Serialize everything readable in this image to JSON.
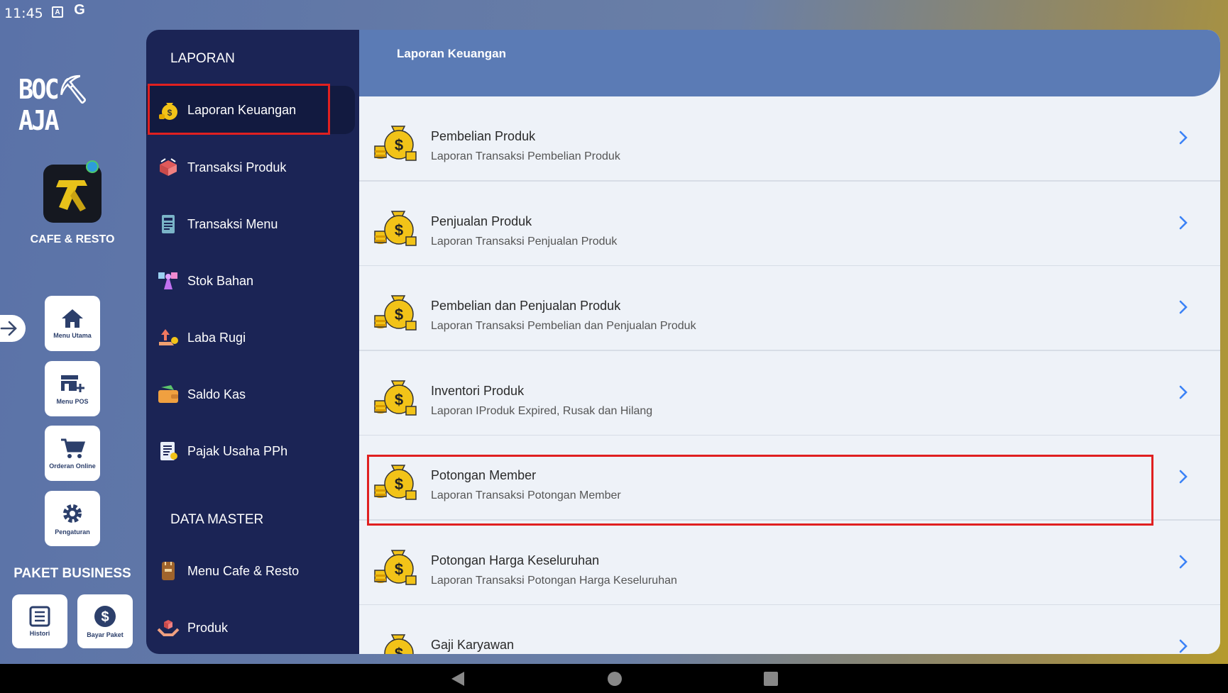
{
  "status_bar": {
    "time": "11:45",
    "icons": [
      "a-badge-icon",
      "google-icon"
    ]
  },
  "left_rail": {
    "logo_text": "BOC⛏AJA",
    "app_label": "CAFE & RESTO",
    "tiles": [
      {
        "label": "Menu Utama",
        "icon": "home-icon"
      },
      {
        "label": "Menu POS",
        "icon": "store-add-icon"
      },
      {
        "label": "Orderan Online",
        "icon": "cart-icon"
      },
      {
        "label": "Pengaturan",
        "icon": "gear-icon"
      }
    ],
    "paket_label": "PAKET BUSINESS",
    "paket_tiles": [
      {
        "label": "Histori",
        "icon": "list-icon"
      },
      {
        "label": "Bayar Paket",
        "icon": "dollar-icon"
      }
    ]
  },
  "menu": {
    "section_laporan": "LAPORAN",
    "laporan_items": [
      {
        "label": "Laporan Keuangan",
        "active": true
      },
      {
        "label": "Transaksi Produk"
      },
      {
        "label": "Transaksi Menu"
      },
      {
        "label": "Stok Bahan"
      },
      {
        "label": "Laba Rugi"
      },
      {
        "label": "Saldo Kas"
      },
      {
        "label": "Pajak Usaha PPh"
      }
    ],
    "section_master": "DATA MASTER",
    "master_items": [
      {
        "label": "Menu Cafe & Resto"
      },
      {
        "label": "Produk"
      }
    ]
  },
  "content": {
    "title": "Laporan Keuangan",
    "rows": [
      {
        "title": "Pembelian Produk",
        "subtitle": "Laporan Transaksi Pembelian Produk"
      },
      {
        "title": "Penjualan Produk",
        "subtitle": "Laporan Transaksi Penjualan Produk"
      },
      {
        "title": "Pembelian dan Penjualan Produk",
        "subtitle": "Laporan Transaksi Pembelian dan Penjualan Produk"
      },
      {
        "title": "Inventori Produk",
        "subtitle": "Laporan IProduk Expired, Rusak dan Hilang"
      },
      {
        "title": "Potongan Member",
        "subtitle": "Laporan Transaksi Potongan Member"
      },
      {
        "title": "Potongan Harga Keseluruhan",
        "subtitle": "Laporan Transaksi Potongan Harga Keseluruhan"
      },
      {
        "title": "Gaji Karyawan",
        "subtitle": ""
      }
    ]
  },
  "colors": {
    "menu_bg": "#1b2455",
    "header_bg": "#5b7bb5",
    "highlight": "#e02020",
    "accent_blue": "#3b82f6"
  }
}
